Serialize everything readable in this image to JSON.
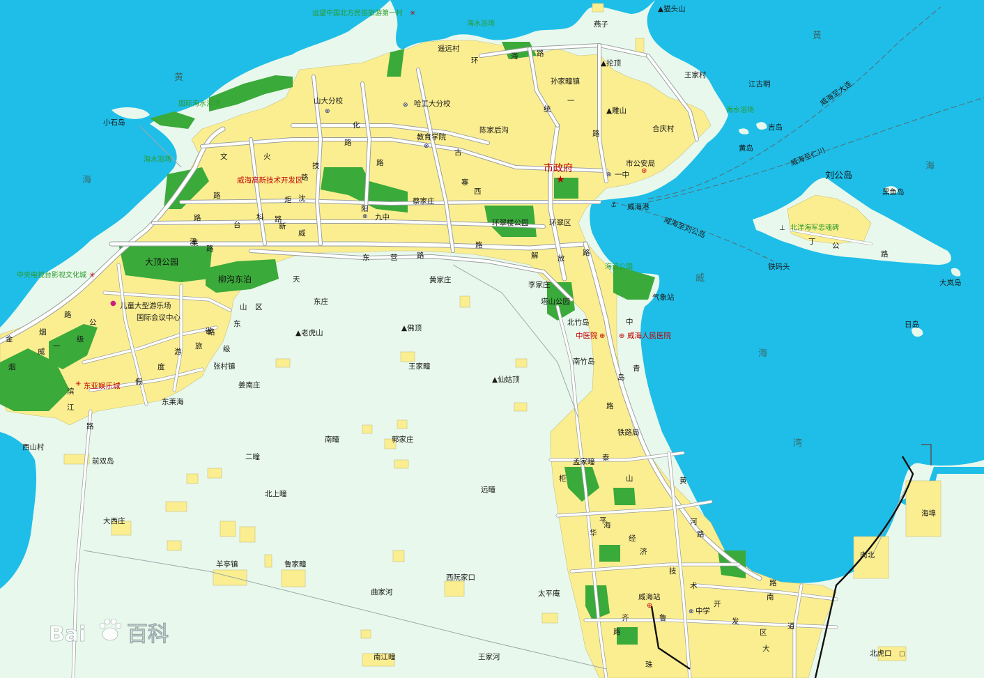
{
  "colors": {
    "sea": "#1ebee8",
    "land": "#e8f8ec",
    "urban": "#fbee90",
    "park": "#3aaa3a",
    "road": "#ffffff"
  },
  "water_labels": [
    {
      "id": "huang-nw",
      "text": "黄"
    },
    {
      "id": "hai-w",
      "text": "海"
    },
    {
      "id": "huang-ne",
      "text": "黄"
    },
    {
      "id": "hai-ne",
      "text": "海"
    },
    {
      "id": "wei-bay-1",
      "text": "威"
    },
    {
      "id": "wei-bay-2",
      "text": "海"
    },
    {
      "id": "wei-bay-3",
      "text": "湾"
    }
  ],
  "district_labels": [
    {
      "id": "gaoxin",
      "text": "威海高新技术开发区"
    },
    {
      "id": "huancui",
      "text": "环翠区"
    },
    {
      "id": "gov",
      "text": "市政府"
    },
    {
      "id": "liugong",
      "text": "刘公岛"
    }
  ],
  "parks": [
    {
      "id": "dading",
      "text": "大顶公园"
    },
    {
      "id": "liugou",
      "text": "柳沟东泊"
    },
    {
      "id": "huancuilou",
      "text": "环翠楼公园"
    },
    {
      "id": "tashan",
      "text": "塔山公园"
    }
  ],
  "peaks": [
    {
      "id": "maotou",
      "text": "猫头山"
    },
    {
      "id": "lunding",
      "text": "抡顶"
    },
    {
      "id": "diaoshan",
      "text": "雕山"
    },
    {
      "id": "laohu",
      "text": "老虎山"
    },
    {
      "id": "fo",
      "text": "佛顶"
    },
    {
      "id": "xiangu",
      "text": "仙姑顶"
    }
  ],
  "pois": [
    {
      "id": "shanda",
      "text": "山大分校"
    },
    {
      "id": "hagong",
      "text": "哈工大分校"
    },
    {
      "id": "jiaoyu",
      "text": "教育学院"
    },
    {
      "id": "jiuzhong",
      "text": "九中"
    },
    {
      "id": "yizhong",
      "text": "一中"
    },
    {
      "id": "gongan",
      "text": "市公安局"
    },
    {
      "id": "ertong",
      "text": "儿童大型游乐场"
    },
    {
      "id": "guoji",
      "text": "国际会议中心"
    },
    {
      "id": "dongya",
      "text": "东亚娱乐城"
    },
    {
      "id": "zhongyi",
      "text": "中医院"
    },
    {
      "id": "renmin",
      "text": "威海人民医院"
    },
    {
      "id": "qixiang",
      "text": "气象站"
    },
    {
      "id": "weihaigang",
      "text": "威海港"
    },
    {
      "id": "weihaizhan",
      "text": "威海站"
    },
    {
      "id": "zhongxue",
      "text": "中学"
    },
    {
      "id": "haibu",
      "text": "海埠"
    },
    {
      "id": "beihukou",
      "text": "北虎口"
    },
    {
      "id": "roubei",
      "text": "肉北"
    }
  ],
  "places": [
    {
      "id": "yuanyuan",
      "text": "遥远村"
    },
    {
      "id": "yanzi",
      "text": "燕子"
    },
    {
      "id": "sunjiatuan",
      "text": "孙家疃镇"
    },
    {
      "id": "wangjia-ne",
      "text": "王家村"
    },
    {
      "id": "jianggu",
      "text": "江古明"
    },
    {
      "id": "heqing",
      "text": "合庆村"
    },
    {
      "id": "jidao",
      "text": "吉岛"
    },
    {
      "id": "huangdao",
      "text": "黄岛"
    },
    {
      "id": "chenjiahou",
      "text": "陈家后沟"
    },
    {
      "id": "caijia",
      "text": "蔡家庄"
    },
    {
      "id": "huangjia",
      "text": "黄家庄"
    },
    {
      "id": "lijia",
      "text": "李家庄"
    },
    {
      "id": "beizhudao",
      "text": "北竹岛"
    },
    {
      "id": "nanzhudao",
      "text": "南竹岛"
    },
    {
      "id": "tielu",
      "text": "铁路局"
    },
    {
      "id": "mengjia",
      "text": "孟家疃"
    },
    {
      "id": "dongzhuang",
      "text": "东庄"
    },
    {
      "id": "wangjiatuan",
      "text": "王家疃"
    },
    {
      "id": "zhangcun",
      "text": "张村镇"
    },
    {
      "id": "jiangnan",
      "text": "姜南庄"
    },
    {
      "id": "donglai",
      "text": "东莱海"
    },
    {
      "id": "xishan",
      "text": "西山村"
    },
    {
      "id": "qianshuang",
      "text": "前双岛"
    },
    {
      "id": "nanzhuang",
      "text": "南疃"
    },
    {
      "id": "guojia",
      "text": "郭家庄"
    },
    {
      "id": "erzhuang",
      "text": "二疃"
    },
    {
      "id": "beishang",
      "text": "北上疃"
    },
    {
      "id": "yuanzhuang",
      "text": "远疃"
    },
    {
      "id": "daxi",
      "text": "大西庄"
    },
    {
      "id": "yangting",
      "text": "羊亭镇"
    },
    {
      "id": "lujia",
      "text": "鲁家疃"
    },
    {
      "id": "xiruan",
      "text": "西阮家口"
    },
    {
      "id": "qujia",
      "text": "曲家河"
    },
    {
      "id": "taiping",
      "text": "太平庵"
    },
    {
      "id": "nanjiang",
      "text": "南江疃"
    },
    {
      "id": "wangjiahe",
      "text": "王家河"
    },
    {
      "id": "xiaoshi",
      "text": "小石岛"
    },
    {
      "id": "heiyu",
      "text": "黑鱼岛"
    },
    {
      "id": "matou",
      "text": "铁码头"
    },
    {
      "id": "dalan",
      "text": "大岚岛"
    },
    {
      "id": "ridao",
      "text": "日岛"
    },
    {
      "id": "jin",
      "text": "金"
    },
    {
      "id": "yan",
      "text": "烟"
    }
  ],
  "green_labels": [
    {
      "id": "liugong-bei",
      "text": "北洋海军忠魂碑"
    },
    {
      "id": "guoji-hai",
      "text": "国际海水浴场"
    },
    {
      "id": "haishui-w",
      "text": "海水浴场"
    },
    {
      "id": "haishui-n",
      "text": "海水浴场"
    },
    {
      "id": "haishui-ne",
      "text": "海水浴场"
    },
    {
      "id": "haibin",
      "text": "海滨公园"
    },
    {
      "id": "top-attr",
      "text": "远望中国北方民俗旅游第一村"
    },
    {
      "id": "yingshi",
      "text": "中央电视台影视文化城"
    }
  ],
  "routes": [
    {
      "id": "r1",
      "text": "威海至大连"
    },
    {
      "id": "r2",
      "text": "威海至仁川"
    },
    {
      "id": "r3",
      "text": "威海至刘公岛"
    }
  ],
  "road_chars": [
    {
      "id": "c1",
      "text": "文"
    },
    {
      "id": "c2",
      "text": "化"
    },
    {
      "id": "c3",
      "text": "路"
    },
    {
      "id": "c4",
      "text": "环"
    },
    {
      "id": "c5",
      "text": "海"
    },
    {
      "id": "c6",
      "text": "路"
    },
    {
      "id": "c7",
      "text": "统"
    },
    {
      "id": "c8",
      "text": "一"
    },
    {
      "id": "c9",
      "text": "路"
    },
    {
      "id": "c10",
      "text": "古"
    },
    {
      "id": "c11",
      "text": "寨"
    },
    {
      "id": "c12",
      "text": "西"
    },
    {
      "id": "c13",
      "text": "路"
    },
    {
      "id": "c14",
      "text": "新"
    },
    {
      "id": "c15",
      "text": "威"
    },
    {
      "id": "c16",
      "text": "路"
    },
    {
      "id": "c17",
      "text": "沈"
    },
    {
      "id": "c18",
      "text": "阳"
    },
    {
      "id": "c19",
      "text": "路"
    },
    {
      "id": "c20",
      "text": "火"
    },
    {
      "id": "c21",
      "text": "炬"
    },
    {
      "id": "c22",
      "text": "路"
    },
    {
      "id": "c23",
      "text": "台"
    },
    {
      "id": "c24",
      "text": "路"
    },
    {
      "id": "c25",
      "text": "东"
    },
    {
      "id": "c26",
      "text": "营"
    },
    {
      "id": "c27",
      "text": "路"
    },
    {
      "id": "c28",
      "text": "解"
    },
    {
      "id": "c29",
      "text": "放"
    },
    {
      "id": "c30",
      "text": "路"
    },
    {
      "id": "c31",
      "text": "天"
    },
    {
      "id": "c32",
      "text": "津"
    },
    {
      "id": "c33",
      "text": "路"
    },
    {
      "id": "c34",
      "text": "科"
    },
    {
      "id": "c35",
      "text": "技"
    },
    {
      "id": "c36",
      "text": "路"
    },
    {
      "id": "c37",
      "text": "山"
    },
    {
      "id": "c38",
      "text": "东"
    },
    {
      "id": "c39",
      "text": "路"
    },
    {
      "id": "c40",
      "text": "省"
    },
    {
      "id": "c41",
      "text": "级"
    },
    {
      "id": "c42",
      "text": "旅"
    },
    {
      "id": "c43",
      "text": "游"
    },
    {
      "id": "c44",
      "text": "度"
    },
    {
      "id": "c45",
      "text": "假"
    },
    {
      "id": "c46",
      "text": "区"
    },
    {
      "id": "c47",
      "text": "莱"
    },
    {
      "id": "c48",
      "text": "烟"
    },
    {
      "id": "c49",
      "text": "威"
    },
    {
      "id": "c50",
      "text": "一"
    },
    {
      "id": "c51",
      "text": "级"
    },
    {
      "id": "c52",
      "text": "公"
    },
    {
      "id": "c53",
      "text": "路"
    },
    {
      "id": "c54",
      "text": "滨"
    },
    {
      "id": "c55",
      "text": "中"
    },
    {
      "id": "c56",
      "text": "青"
    },
    {
      "id": "c57",
      "text": "岛"
    },
    {
      "id": "c58",
      "text": "路"
    },
    {
      "id": "c59",
      "text": "泰"
    },
    {
      "id": "c60",
      "text": "山"
    },
    {
      "id": "c61",
      "text": "黄"
    },
    {
      "id": "c62",
      "text": "河"
    },
    {
      "id": "c63",
      "text": "路"
    },
    {
      "id": "c64",
      "text": "华"
    },
    {
      "id": "c65",
      "text": "平"
    },
    {
      "id": "c66",
      "text": "海"
    },
    {
      "id": "c67",
      "text": "经"
    },
    {
      "id": "c68",
      "text": "济"
    },
    {
      "id": "c69",
      "text": "技"
    },
    {
      "id": "c70",
      "text": "术"
    },
    {
      "id": "c71",
      "text": "开"
    },
    {
      "id": "c72",
      "text": "发"
    },
    {
      "id": "c73",
      "text": "区"
    },
    {
      "id": "c74",
      "text": "大"
    },
    {
      "id": "c75",
      "text": "道"
    },
    {
      "id": "c76",
      "text": "柜"
    },
    {
      "id": "c77",
      "text": "齐"
    },
    {
      "id": "c78",
      "text": "鲁"
    },
    {
      "id": "c79",
      "text": "路"
    },
    {
      "id": "c80",
      "text": "珠"
    },
    {
      "id": "c81",
      "text": "江"
    },
    {
      "id": "c82",
      "text": "路"
    },
    {
      "id": "c83",
      "text": "丁"
    },
    {
      "id": "c84",
      "text": "公"
    },
    {
      "id": "c85",
      "text": "路"
    },
    {
      "id": "c86",
      "text": "南"
    },
    {
      "id": "c87",
      "text": "路"
    }
  ],
  "watermark": {
    "text": "Bai",
    "icon": "paw-icon",
    "suffix": "百科"
  }
}
